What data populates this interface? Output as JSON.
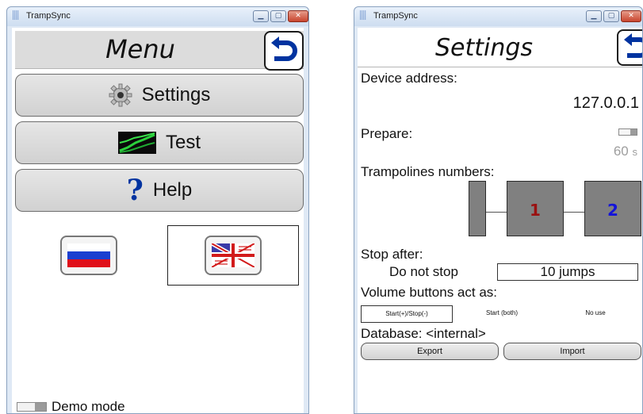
{
  "colors": {
    "accent_blue": "#0033a0",
    "tramp_gray": "#808080",
    "tramp_one": "#9a1111",
    "tramp_two": "#1414d8",
    "muted_value": "#9e9e9e"
  },
  "menu_window": {
    "title": "TrampSync",
    "header": "Menu",
    "back_icon": "undo-arrow-icon",
    "buttons": [
      {
        "label": "Settings",
        "icon": "gear-icon"
      },
      {
        "label": "Test",
        "icon": "signal-chart-icon"
      },
      {
        "label": "Help",
        "icon": "question-mark-icon"
      }
    ],
    "languages": [
      {
        "name": "russian",
        "icon": "russian-flag-icon",
        "selected": false
      },
      {
        "name": "english",
        "icon": "uk-flag-icon",
        "selected": true
      }
    ],
    "demo_mode_label": "Demo mode",
    "demo_mode_on": false
  },
  "settings_window": {
    "title": "TrampSync",
    "header": "Settings",
    "device_address_label": "Device address:",
    "device_address_value": "127.0.0.1",
    "prepare_label": "Prepare:",
    "prepare_on": false,
    "prepare_value": "60",
    "prepare_unit": "s",
    "trampolines_label": "Trampolines numbers:",
    "trampolines": [
      "",
      "1",
      "2"
    ],
    "stop_after_label": "Stop after:",
    "stop_options": [
      "Do not stop",
      "10 jumps"
    ],
    "stop_selected": 1,
    "volume_label": "Volume buttons act as:",
    "volume_options": [
      "Start(+)/Stop(-)",
      "Start (both)",
      "No use"
    ],
    "volume_selected": 0,
    "database_label": "Database: <internal>",
    "export_label": "Export",
    "import_label": "Import"
  }
}
